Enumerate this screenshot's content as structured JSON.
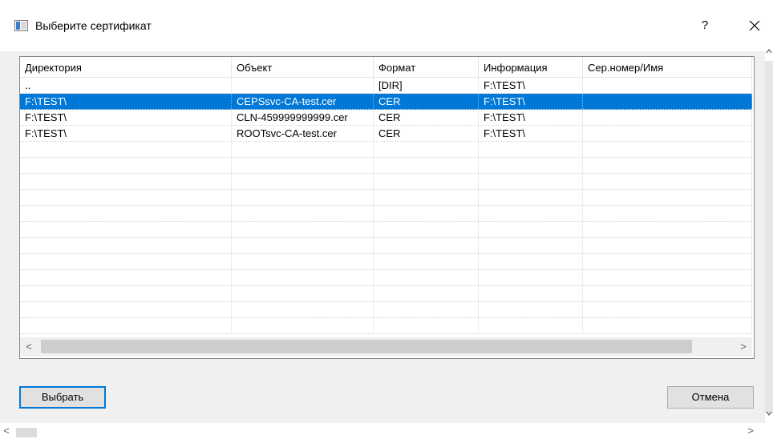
{
  "dialog": {
    "title": "Выберите сертификат",
    "help_label": "?"
  },
  "table": {
    "columns": [
      "Директория",
      "Объект",
      "Формат",
      "Информация",
      "Сер.номер/Имя"
    ],
    "rows": [
      {
        "dir": "..",
        "object": "",
        "format": "[DIR]",
        "info": "F:\\TEST\\",
        "serial": "",
        "selected": false
      },
      {
        "dir": "F:\\TEST\\",
        "object": "CEPSsvc-CA-test.cer",
        "format": "CER",
        "info": "F:\\TEST\\",
        "serial": "",
        "selected": true
      },
      {
        "dir": "F:\\TEST\\",
        "object": "CLN-459999999999.cer",
        "format": "CER",
        "info": "F:\\TEST\\",
        "serial": "",
        "selected": false
      },
      {
        "dir": "F:\\TEST\\",
        "object": "ROOTsvc-CA-test.cer",
        "format": "CER",
        "info": "F:\\TEST\\",
        "serial": "",
        "selected": false
      }
    ],
    "empty_rows": 12
  },
  "buttons": {
    "choose": "Выбрать",
    "cancel": "Отмена"
  },
  "scroll": {
    "left_arrow": "<",
    "right_arrow": ">"
  },
  "colors": {
    "selection": "#0078d7",
    "dialog_bg": "#f0f0f0",
    "default_button_border": "#0078d7"
  }
}
